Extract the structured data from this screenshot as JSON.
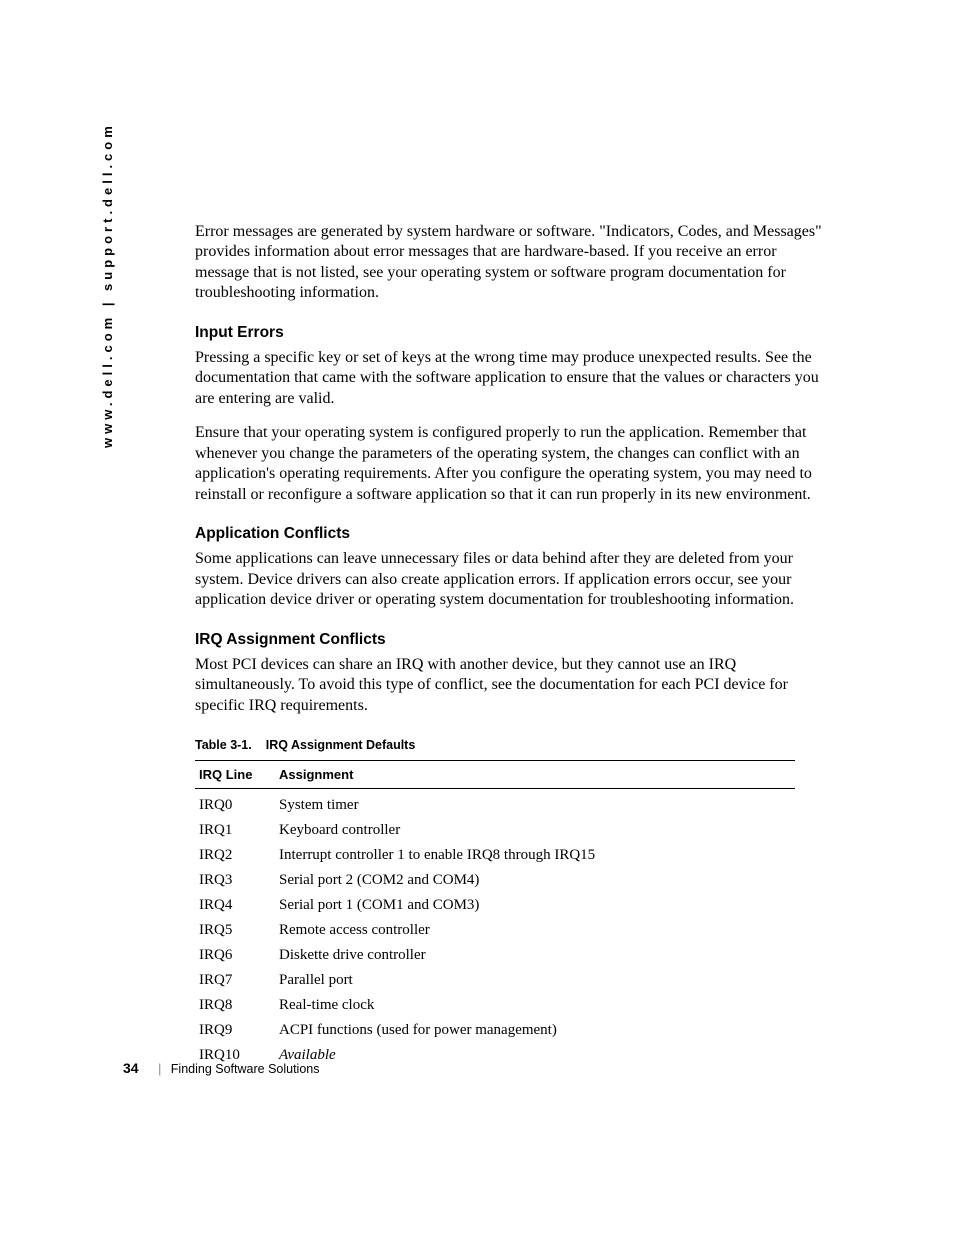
{
  "sidebar": {
    "text": "www.dell.com | support.dell.com"
  },
  "intro": "Error messages are generated by system hardware or software. \"Indicators, Codes, and Messages\" provides information about error messages that are hardware-based. If you receive an error message that is not listed, see your operating system or software program documentation for troubleshooting information.",
  "sections": {
    "input_errors": {
      "heading": "Input Errors",
      "p1": "Pressing a specific key or set of keys at the wrong time may produce unexpected results. See the documentation that came with the software application to ensure that the values or characters you are entering are valid.",
      "p2": "Ensure that your operating system is configured properly to run the application. Remember that whenever you change the parameters of the operating system, the changes can conflict with an application's operating requirements. After you configure the operating system, you may need to reinstall or reconfigure a software application so that it can run properly in its new environment."
    },
    "app_conflicts": {
      "heading": "Application Conflicts",
      "p1": "Some applications can leave unnecessary files or data behind after they are deleted from your system. Device drivers can also create application errors. If application errors occur, see your application device driver or operating system documentation for troubleshooting information."
    },
    "irq": {
      "heading": "IRQ Assignment Conflicts",
      "p1": "Most PCI devices can share an IRQ with another device, but they cannot use an IRQ simultaneously. To avoid this type of conflict, see the documentation for each PCI device for specific IRQ requirements."
    }
  },
  "table": {
    "caption_number": "Table 3-1.",
    "caption_title": "IRQ Assignment Defaults",
    "headers": {
      "line": "IRQ Line",
      "assignment": "Assignment"
    },
    "rows": [
      {
        "line": "IRQ0",
        "assignment": "System timer",
        "italic": false
      },
      {
        "line": "IRQ1",
        "assignment": "Keyboard controller",
        "italic": false
      },
      {
        "line": "IRQ2",
        "assignment": "Interrupt controller 1 to enable IRQ8 through IRQ15",
        "italic": false
      },
      {
        "line": "IRQ3",
        "assignment": "Serial port 2 (COM2 and COM4)",
        "italic": false
      },
      {
        "line": "IRQ4",
        "assignment": "Serial port 1 (COM1 and COM3)",
        "italic": false
      },
      {
        "line": "IRQ5",
        "assignment": "Remote access controller",
        "italic": false
      },
      {
        "line": "IRQ6",
        "assignment": "Diskette drive controller",
        "italic": false
      },
      {
        "line": "IRQ7",
        "assignment": "Parallel port",
        "italic": false
      },
      {
        "line": "IRQ8",
        "assignment": "Real-time clock",
        "italic": false
      },
      {
        "line": "IRQ9",
        "assignment": "ACPI functions (used for power management)",
        "italic": false
      },
      {
        "line": "IRQ10",
        "assignment": "Available",
        "italic": true
      }
    ]
  },
  "footer": {
    "page_number": "34",
    "section": "Finding Software Solutions"
  }
}
